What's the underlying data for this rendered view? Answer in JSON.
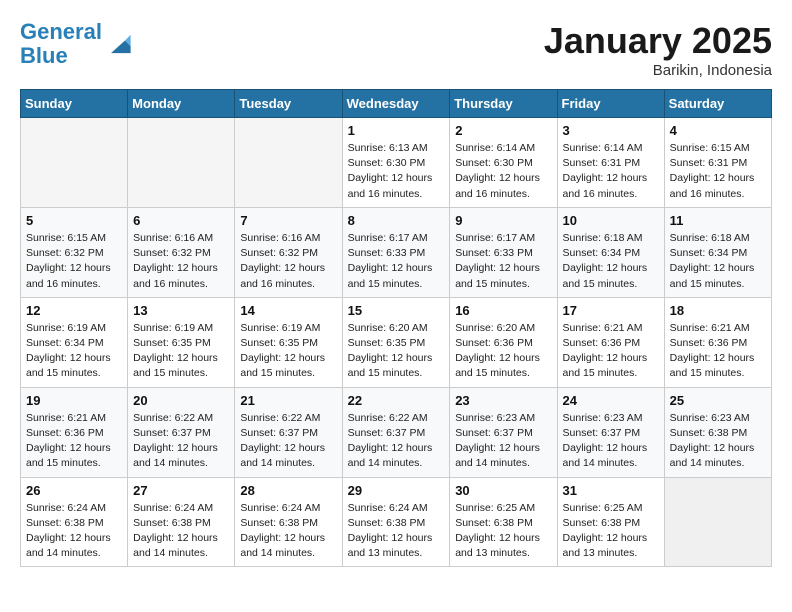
{
  "header": {
    "logo_line1": "General",
    "logo_line2": "Blue",
    "month_title": "January 2025",
    "location": "Barikin, Indonesia"
  },
  "days_of_week": [
    "Sunday",
    "Monday",
    "Tuesday",
    "Wednesday",
    "Thursday",
    "Friday",
    "Saturday"
  ],
  "weeks": [
    [
      {
        "day": "",
        "sunrise": "",
        "sunset": "",
        "daylight": ""
      },
      {
        "day": "",
        "sunrise": "",
        "sunset": "",
        "daylight": ""
      },
      {
        "day": "",
        "sunrise": "",
        "sunset": "",
        "daylight": ""
      },
      {
        "day": "1",
        "sunrise": "6:13 AM",
        "sunset": "6:30 PM",
        "daylight": "12 hours and 16 minutes."
      },
      {
        "day": "2",
        "sunrise": "6:14 AM",
        "sunset": "6:30 PM",
        "daylight": "12 hours and 16 minutes."
      },
      {
        "day": "3",
        "sunrise": "6:14 AM",
        "sunset": "6:31 PM",
        "daylight": "12 hours and 16 minutes."
      },
      {
        "day": "4",
        "sunrise": "6:15 AM",
        "sunset": "6:31 PM",
        "daylight": "12 hours and 16 minutes."
      }
    ],
    [
      {
        "day": "5",
        "sunrise": "6:15 AM",
        "sunset": "6:32 PM",
        "daylight": "12 hours and 16 minutes."
      },
      {
        "day": "6",
        "sunrise": "6:16 AM",
        "sunset": "6:32 PM",
        "daylight": "12 hours and 16 minutes."
      },
      {
        "day": "7",
        "sunrise": "6:16 AM",
        "sunset": "6:32 PM",
        "daylight": "12 hours and 16 minutes."
      },
      {
        "day": "8",
        "sunrise": "6:17 AM",
        "sunset": "6:33 PM",
        "daylight": "12 hours and 15 minutes."
      },
      {
        "day": "9",
        "sunrise": "6:17 AM",
        "sunset": "6:33 PM",
        "daylight": "12 hours and 15 minutes."
      },
      {
        "day": "10",
        "sunrise": "6:18 AM",
        "sunset": "6:34 PM",
        "daylight": "12 hours and 15 minutes."
      },
      {
        "day": "11",
        "sunrise": "6:18 AM",
        "sunset": "6:34 PM",
        "daylight": "12 hours and 15 minutes."
      }
    ],
    [
      {
        "day": "12",
        "sunrise": "6:19 AM",
        "sunset": "6:34 PM",
        "daylight": "12 hours and 15 minutes."
      },
      {
        "day": "13",
        "sunrise": "6:19 AM",
        "sunset": "6:35 PM",
        "daylight": "12 hours and 15 minutes."
      },
      {
        "day": "14",
        "sunrise": "6:19 AM",
        "sunset": "6:35 PM",
        "daylight": "12 hours and 15 minutes."
      },
      {
        "day": "15",
        "sunrise": "6:20 AM",
        "sunset": "6:35 PM",
        "daylight": "12 hours and 15 minutes."
      },
      {
        "day": "16",
        "sunrise": "6:20 AM",
        "sunset": "6:36 PM",
        "daylight": "12 hours and 15 minutes."
      },
      {
        "day": "17",
        "sunrise": "6:21 AM",
        "sunset": "6:36 PM",
        "daylight": "12 hours and 15 minutes."
      },
      {
        "day": "18",
        "sunrise": "6:21 AM",
        "sunset": "6:36 PM",
        "daylight": "12 hours and 15 minutes."
      }
    ],
    [
      {
        "day": "19",
        "sunrise": "6:21 AM",
        "sunset": "6:36 PM",
        "daylight": "12 hours and 15 minutes."
      },
      {
        "day": "20",
        "sunrise": "6:22 AM",
        "sunset": "6:37 PM",
        "daylight": "12 hours and 14 minutes."
      },
      {
        "day": "21",
        "sunrise": "6:22 AM",
        "sunset": "6:37 PM",
        "daylight": "12 hours and 14 minutes."
      },
      {
        "day": "22",
        "sunrise": "6:22 AM",
        "sunset": "6:37 PM",
        "daylight": "12 hours and 14 minutes."
      },
      {
        "day": "23",
        "sunrise": "6:23 AM",
        "sunset": "6:37 PM",
        "daylight": "12 hours and 14 minutes."
      },
      {
        "day": "24",
        "sunrise": "6:23 AM",
        "sunset": "6:37 PM",
        "daylight": "12 hours and 14 minutes."
      },
      {
        "day": "25",
        "sunrise": "6:23 AM",
        "sunset": "6:38 PM",
        "daylight": "12 hours and 14 minutes."
      }
    ],
    [
      {
        "day": "26",
        "sunrise": "6:24 AM",
        "sunset": "6:38 PM",
        "daylight": "12 hours and 14 minutes."
      },
      {
        "day": "27",
        "sunrise": "6:24 AM",
        "sunset": "6:38 PM",
        "daylight": "12 hours and 14 minutes."
      },
      {
        "day": "28",
        "sunrise": "6:24 AM",
        "sunset": "6:38 PM",
        "daylight": "12 hours and 14 minutes."
      },
      {
        "day": "29",
        "sunrise": "6:24 AM",
        "sunset": "6:38 PM",
        "daylight": "12 hours and 13 minutes."
      },
      {
        "day": "30",
        "sunrise": "6:25 AM",
        "sunset": "6:38 PM",
        "daylight": "12 hours and 13 minutes."
      },
      {
        "day": "31",
        "sunrise": "6:25 AM",
        "sunset": "6:38 PM",
        "daylight": "12 hours and 13 minutes."
      },
      {
        "day": "",
        "sunrise": "",
        "sunset": "",
        "daylight": ""
      }
    ]
  ],
  "labels": {
    "sunrise_prefix": "Sunrise: ",
    "sunset_prefix": "Sunset: ",
    "daylight_prefix": "Daylight: "
  }
}
